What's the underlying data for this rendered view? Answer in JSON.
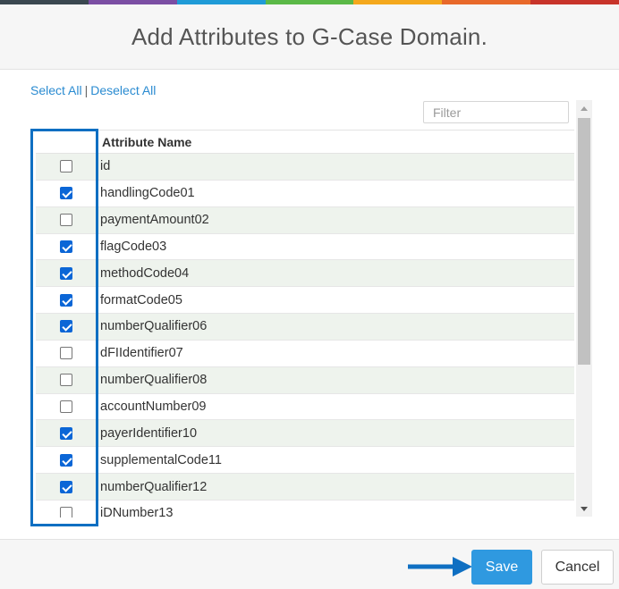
{
  "topbar_colors": [
    "#3a4750",
    "#7b4ea3",
    "#1f9bd7",
    "#5bb947",
    "#f4a81d",
    "#e8692a",
    "#c8342a"
  ],
  "dialog": {
    "title": "Add Attributes to G-Case Domain."
  },
  "selection": {
    "select_all": "Select All",
    "separator": "|",
    "deselect_all": "Deselect All"
  },
  "filter": {
    "placeholder": "Filter",
    "value": ""
  },
  "table": {
    "column_header": "Attribute Name",
    "rows": [
      {
        "name": "id",
        "checked": false
      },
      {
        "name": "handlingCode01",
        "checked": true
      },
      {
        "name": "paymentAmount02",
        "checked": false
      },
      {
        "name": "flagCode03",
        "checked": true
      },
      {
        "name": "methodCode04",
        "checked": true
      },
      {
        "name": "formatCode05",
        "checked": true
      },
      {
        "name": "numberQualifier06",
        "checked": true
      },
      {
        "name": "dFIIdentifier07",
        "checked": false
      },
      {
        "name": "numberQualifier08",
        "checked": false
      },
      {
        "name": "accountNumber09",
        "checked": false
      },
      {
        "name": "payerIdentifier10",
        "checked": true
      },
      {
        "name": "supplementalCode11",
        "checked": true
      },
      {
        "name": "numberQualifier12",
        "checked": true
      },
      {
        "name": "iDNumber13",
        "checked": false
      }
    ]
  },
  "buttons": {
    "save": "Save",
    "cancel": "Cancel"
  },
  "colors": {
    "accent": "#2f99e0",
    "highlight": "#0f6fc2",
    "checkbox_checked": "#0b66d6",
    "link": "#2a8bd1"
  }
}
